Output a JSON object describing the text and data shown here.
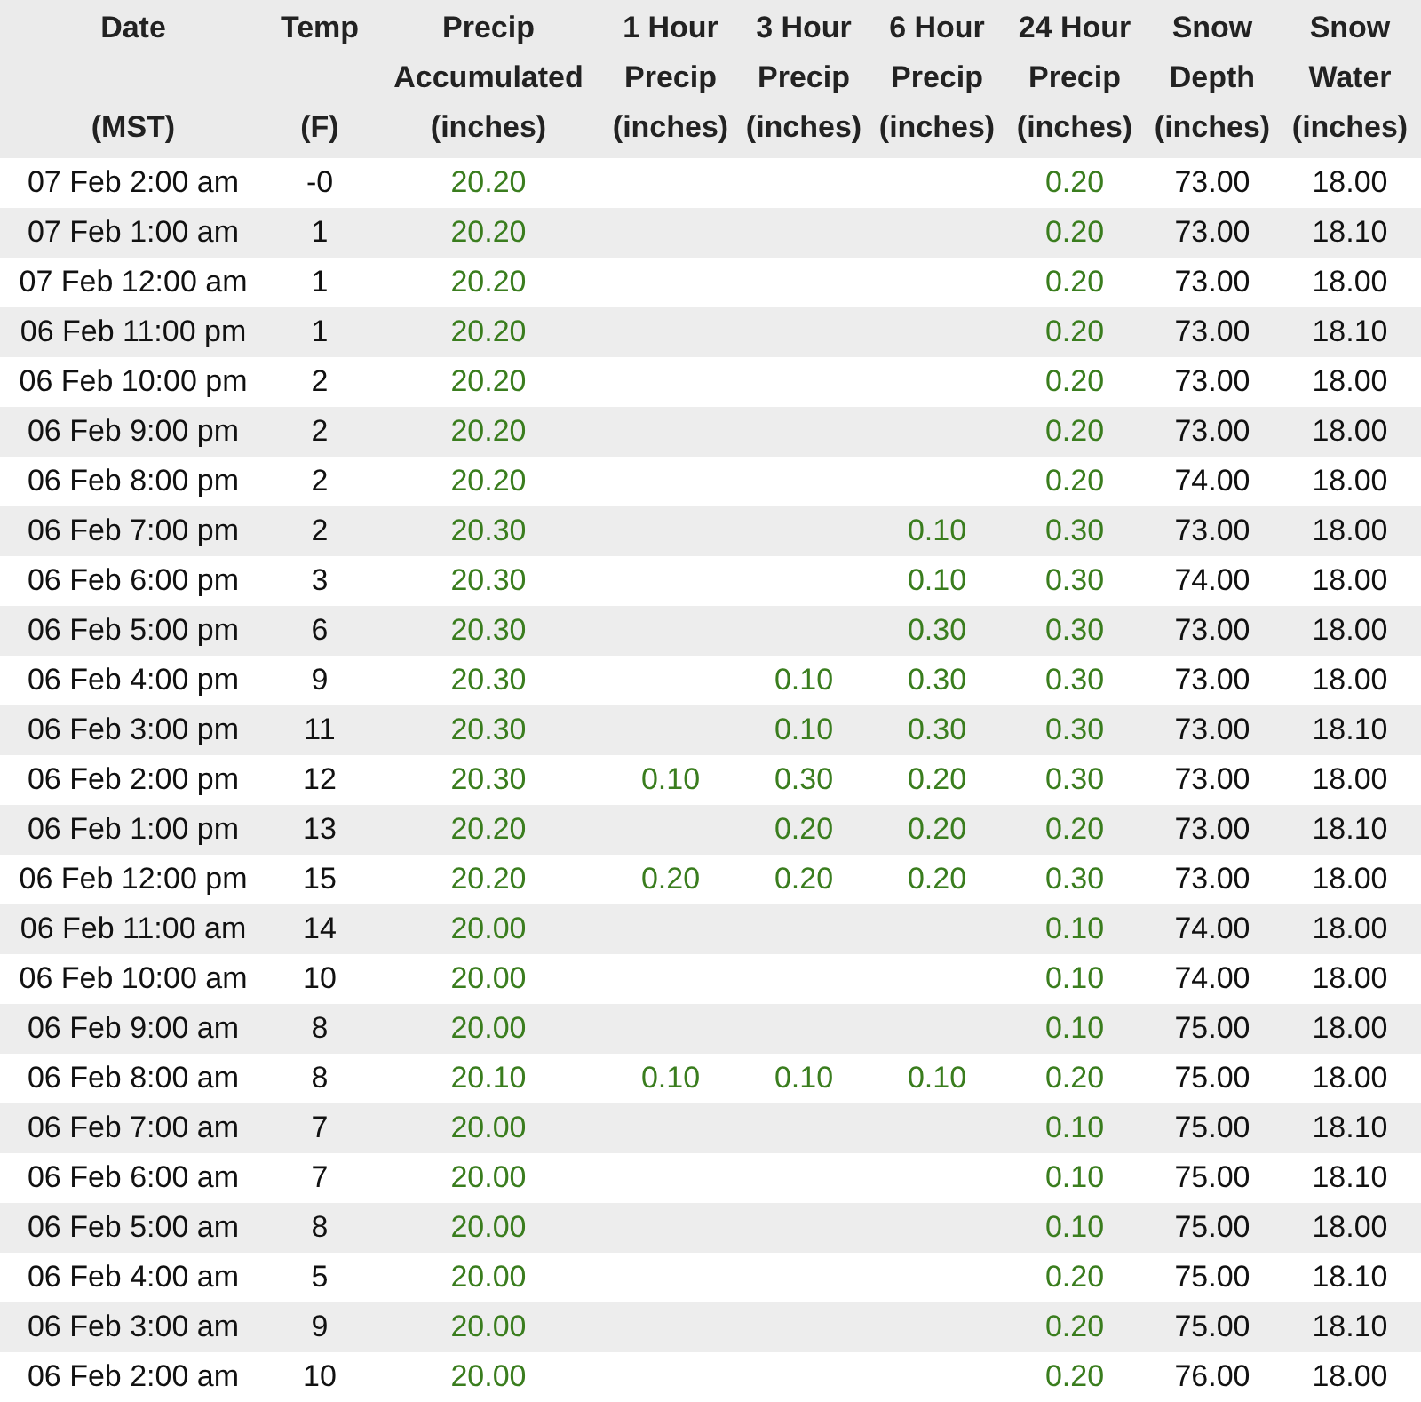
{
  "table": {
    "columns": [
      {
        "kind": "value",
        "line1": "Date",
        "line3": "(MST)"
      },
      {
        "kind": "value",
        "line1": "Temp",
        "line3": "(F)"
      },
      {
        "kind": "precip",
        "line1": "Precip",
        "line2": "Accumulated",
        "line3": "(inches)"
      },
      {
        "kind": "precip",
        "line1": "1 Hour",
        "line2": "Precip",
        "line3": "(inches)"
      },
      {
        "kind": "precip",
        "line1": "3 Hour",
        "line2": "Precip",
        "line3": "(inches)"
      },
      {
        "kind": "precip",
        "line1": "6 Hour",
        "line2": "Precip",
        "line3": "(inches)"
      },
      {
        "kind": "precip",
        "line1": "24 Hour",
        "line2": "Precip",
        "line3": "(inches)"
      },
      {
        "kind": "value",
        "line1": "Snow",
        "line2": "Depth",
        "line3": "(inches)"
      },
      {
        "kind": "value",
        "line1": "Snow",
        "line2": "Water",
        "line3": "(inches)"
      }
    ],
    "rows": [
      [
        "07 Feb 2:00 am",
        "-0",
        "20.20",
        null,
        null,
        null,
        "0.20",
        "73.00",
        "18.00"
      ],
      [
        "07 Feb 1:00 am",
        "1",
        "20.20",
        null,
        null,
        null,
        "0.20",
        "73.00",
        "18.10"
      ],
      [
        "07 Feb 12:00 am",
        "1",
        "20.20",
        null,
        null,
        null,
        "0.20",
        "73.00",
        "18.00"
      ],
      [
        "06 Feb 11:00 pm",
        "1",
        "20.20",
        null,
        null,
        null,
        "0.20",
        "73.00",
        "18.10"
      ],
      [
        "06 Feb 10:00 pm",
        "2",
        "20.20",
        null,
        null,
        null,
        "0.20",
        "73.00",
        "18.00"
      ],
      [
        "06 Feb 9:00 pm",
        "2",
        "20.20",
        null,
        null,
        null,
        "0.20",
        "73.00",
        "18.00"
      ],
      [
        "06 Feb 8:00 pm",
        "2",
        "20.20",
        null,
        null,
        null,
        "0.20",
        "74.00",
        "18.00"
      ],
      [
        "06 Feb 7:00 pm",
        "2",
        "20.30",
        null,
        null,
        "0.10",
        "0.30",
        "73.00",
        "18.00"
      ],
      [
        "06 Feb 6:00 pm",
        "3",
        "20.30",
        null,
        null,
        "0.10",
        "0.30",
        "74.00",
        "18.00"
      ],
      [
        "06 Feb 5:00 pm",
        "6",
        "20.30",
        null,
        null,
        "0.30",
        "0.30",
        "73.00",
        "18.00"
      ],
      [
        "06 Feb 4:00 pm",
        "9",
        "20.30",
        null,
        "0.10",
        "0.30",
        "0.30",
        "73.00",
        "18.00"
      ],
      [
        "06 Feb 3:00 pm",
        "11",
        "20.30",
        null,
        "0.10",
        "0.30",
        "0.30",
        "73.00",
        "18.10"
      ],
      [
        "06 Feb 2:00 pm",
        "12",
        "20.30",
        "0.10",
        "0.30",
        "0.20",
        "0.30",
        "73.00",
        "18.00"
      ],
      [
        "06 Feb 1:00 pm",
        "13",
        "20.20",
        null,
        "0.20",
        "0.20",
        "0.20",
        "73.00",
        "18.10"
      ],
      [
        "06 Feb 12:00 pm",
        "15",
        "20.20",
        "0.20",
        "0.20",
        "0.20",
        "0.30",
        "73.00",
        "18.00"
      ],
      [
        "06 Feb 11:00 am",
        "14",
        "20.00",
        null,
        null,
        null,
        "0.10",
        "74.00",
        "18.00"
      ],
      [
        "06 Feb 10:00 am",
        "10",
        "20.00",
        null,
        null,
        null,
        "0.10",
        "74.00",
        "18.00"
      ],
      [
        "06 Feb 9:00 am",
        "8",
        "20.00",
        null,
        null,
        null,
        "0.10",
        "75.00",
        "18.00"
      ],
      [
        "06 Feb 8:00 am",
        "8",
        "20.10",
        "0.10",
        "0.10",
        "0.10",
        "0.20",
        "75.00",
        "18.00"
      ],
      [
        "06 Feb 7:00 am",
        "7",
        "20.00",
        null,
        null,
        null,
        "0.10",
        "75.00",
        "18.10"
      ],
      [
        "06 Feb 6:00 am",
        "7",
        "20.00",
        null,
        null,
        null,
        "0.10",
        "75.00",
        "18.10"
      ],
      [
        "06 Feb 5:00 am",
        "8",
        "20.00",
        null,
        null,
        null,
        "0.10",
        "75.00",
        "18.00"
      ],
      [
        "06 Feb 4:00 am",
        "5",
        "20.00",
        null,
        null,
        null,
        "0.20",
        "75.00",
        "18.10"
      ],
      [
        "06 Feb 3:00 am",
        "9",
        "20.00",
        null,
        null,
        null,
        "0.20",
        "75.00",
        "18.10"
      ],
      [
        "06 Feb 2:00 am",
        "10",
        "20.00",
        null,
        null,
        null,
        "0.20",
        "76.00",
        "18.00"
      ]
    ]
  }
}
